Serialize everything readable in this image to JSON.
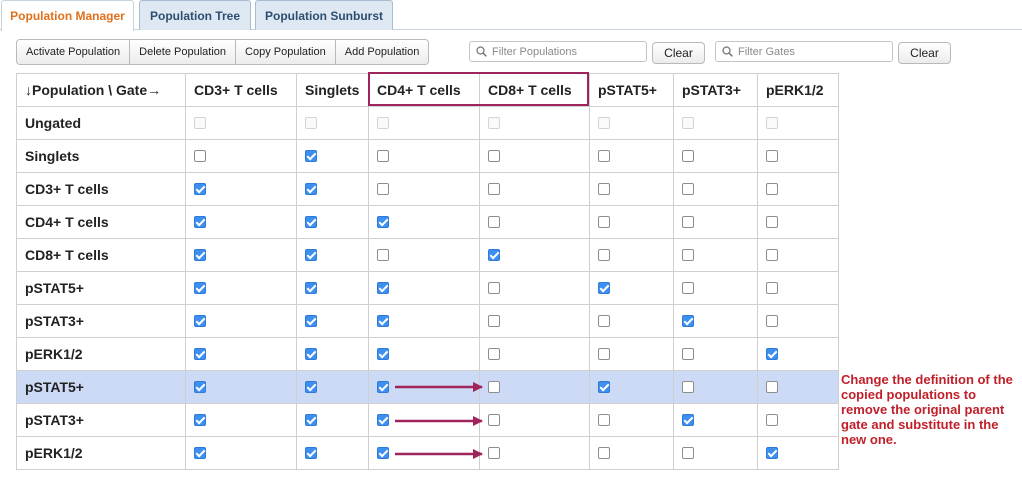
{
  "tabs": [
    {
      "label": "Population Manager",
      "active": true
    },
    {
      "label": "Population Tree",
      "active": false
    },
    {
      "label": "Population Sunburst",
      "active": false
    }
  ],
  "toolbar": {
    "activate_label": "Activate Population",
    "delete_label": "Delete Population",
    "copy_label": "Copy Population",
    "add_label": "Add Population"
  },
  "filters": {
    "populations_placeholder": "Filter Populations",
    "gates_placeholder": "Filter Gates",
    "clear_label": "Clear"
  },
  "grid": {
    "corner_label": "↓Population \\ Gate→",
    "columns": [
      "CD3+ T cells",
      "Singlets",
      "CD4+ T cells",
      "CD8+ T cells",
      "pSTAT5+",
      "pSTAT3+",
      "pERK1/2"
    ],
    "rows": [
      {
        "name": "Ungated",
        "checks": [
          0,
          0,
          0,
          0,
          0,
          0,
          0
        ],
        "disabled": true
      },
      {
        "name": "Singlets",
        "checks": [
          0,
          1,
          0,
          0,
          0,
          0,
          0
        ]
      },
      {
        "name": "CD3+ T cells",
        "checks": [
          1,
          1,
          0,
          0,
          0,
          0,
          0
        ]
      },
      {
        "name": "CD4+ T cells",
        "checks": [
          1,
          1,
          1,
          0,
          0,
          0,
          0
        ]
      },
      {
        "name": "CD8+ T cells",
        "checks": [
          1,
          1,
          0,
          1,
          0,
          0,
          0
        ]
      },
      {
        "name": "pSTAT5+",
        "checks": [
          1,
          1,
          1,
          0,
          1,
          0,
          0
        ]
      },
      {
        "name": "pSTAT3+",
        "checks": [
          1,
          1,
          1,
          0,
          0,
          1,
          0
        ]
      },
      {
        "name": "pERK1/2",
        "checks": [
          1,
          1,
          1,
          0,
          0,
          0,
          1
        ]
      },
      {
        "name": "pSTAT5+",
        "checks": [
          1,
          1,
          1,
          0,
          1,
          0,
          0
        ],
        "selected": true
      },
      {
        "name": "pSTAT3+",
        "checks": [
          1,
          1,
          1,
          0,
          0,
          1,
          0
        ]
      },
      {
        "name": "pERK1/2",
        "checks": [
          1,
          1,
          1,
          0,
          0,
          0,
          1
        ]
      }
    ]
  },
  "annotation": {
    "text": "Change the definition of the copied populations to remove the original parent gate and substitute in the new one.",
    "color": "#c0202a"
  },
  "colors": {
    "active_tab": "#e0701a",
    "highlight_box": "#a0245c",
    "checkbox_checked": "#3d8ff0",
    "selected_row": "#ccdaf5"
  }
}
